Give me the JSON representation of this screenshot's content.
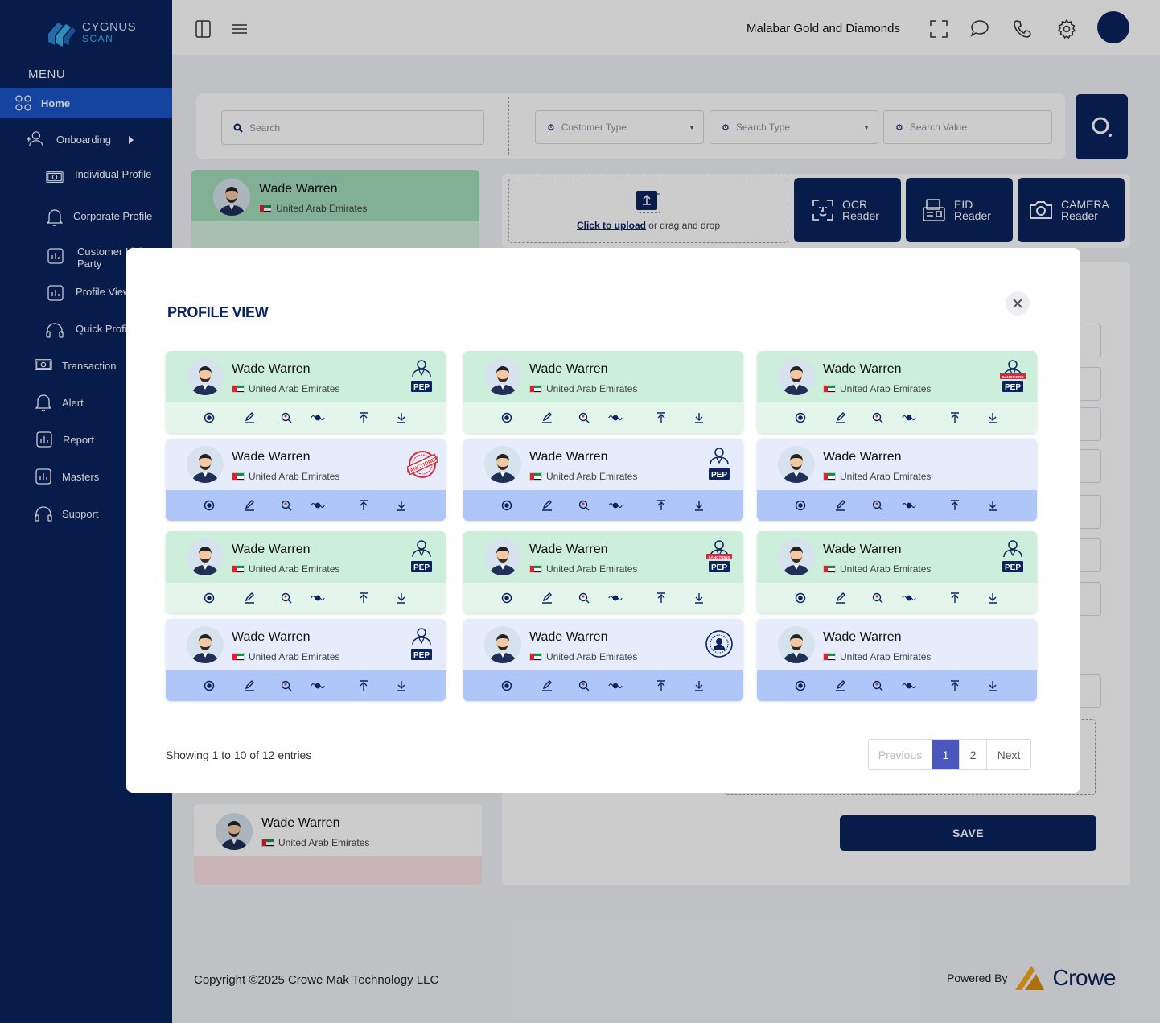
{
  "brand": {
    "line1": "CYGNUS",
    "line2": "SCAN"
  },
  "sidebar": {
    "menu_label": "MENU",
    "items": [
      {
        "label": "Home",
        "icon": "grid-icon"
      },
      {
        "label": "Onboarding",
        "icon": "user-add-icon"
      },
      {
        "label": "Individual Profile",
        "icon": "id-card-icon"
      },
      {
        "label": "Corporate Profile",
        "icon": "bell-icon"
      },
      {
        "label": "Customer Link",
        "label2": "Party",
        "icon": "chart-icon"
      },
      {
        "label": "Profile View",
        "icon": "chart-icon"
      },
      {
        "label": "Quick Profile",
        "icon": "headset-icon"
      },
      {
        "label": "Transaction",
        "icon": "money-icon"
      },
      {
        "label": "Alert",
        "icon": "bell-icon"
      },
      {
        "label": "Report",
        "icon": "chart-icon"
      },
      {
        "label": "Masters",
        "icon": "chart-icon"
      },
      {
        "label": "Support",
        "icon": "headset-icon"
      }
    ]
  },
  "topbar": {
    "company": "Malabar Gold and Diamonds"
  },
  "search": {
    "placeholder": "Search",
    "customer_type": "Customer Type",
    "search_type": "Search Type",
    "search_value": "Search Value"
  },
  "upload": {
    "link": "Click to upload",
    "rest": " or drag and drop"
  },
  "readers": [
    {
      "l1": "OCR",
      "l2": "Reader"
    },
    {
      "l1": "EID",
      "l2": "Reader"
    },
    {
      "l1": "CAMERA",
      "l2": "Reader"
    }
  ],
  "save_label": "SAVE",
  "footer": {
    "copyright": "Copyright ©2025 Crowe Mak Technology LLC",
    "powered": "Powered By",
    "brand": "Crowe"
  },
  "modal": {
    "title": "PROFILE VIEW",
    "showing": "Showing 1 to 10 of 12 entries",
    "pager": {
      "prev": "Previous",
      "p1": "1",
      "p2": "2",
      "next": "Next"
    }
  },
  "profile": {
    "name": "Wade Warren",
    "country": "United Arab Emirates",
    "badge_pep": "PEP",
    "badge_sanctions": "SANCTIONS",
    "badge_stamp": "SANCTIONED"
  },
  "cards": [
    {
      "theme": "green",
      "badge": "pep"
    },
    {
      "theme": "green",
      "badge": "none"
    },
    {
      "theme": "green",
      "badge": "sanctions-pep"
    },
    {
      "theme": "blue",
      "badge": "stamp"
    },
    {
      "theme": "blue",
      "badge": "pep"
    },
    {
      "theme": "blue",
      "badge": "none"
    },
    {
      "theme": "green",
      "badge": "pep"
    },
    {
      "theme": "green",
      "badge": "sanctions-pep"
    },
    {
      "theme": "green",
      "badge": "pep"
    },
    {
      "theme": "blue",
      "badge": "pep"
    },
    {
      "theme": "blue",
      "badge": "seal"
    },
    {
      "theme": "blue",
      "badge": "none"
    }
  ],
  "colors": {
    "navy": "#0b2460",
    "active": "#1b56c8",
    "green": "#cdeedb",
    "blue": "#e6ecfc",
    "pager": "#4a58bd"
  }
}
